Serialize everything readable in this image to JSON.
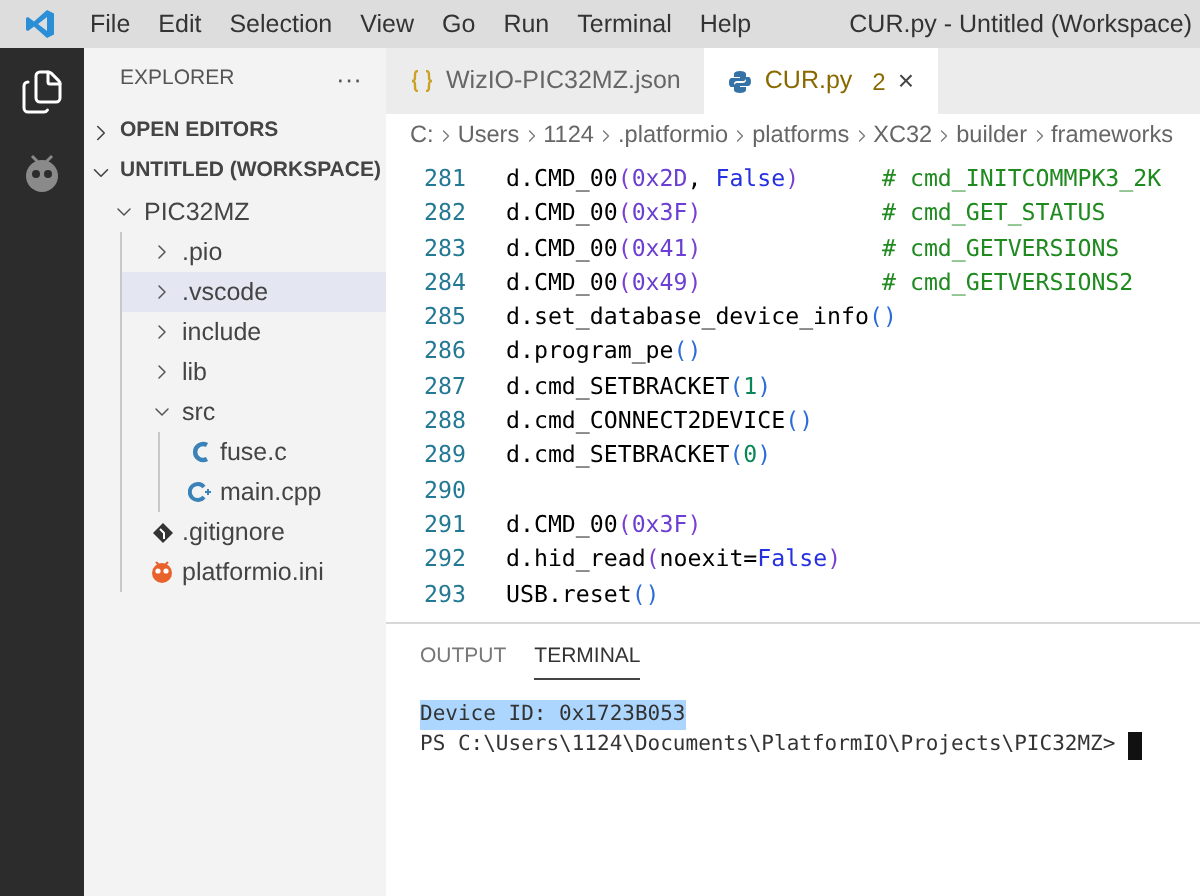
{
  "title_bar": {
    "menu": [
      "File",
      "Edit",
      "Selection",
      "View",
      "Go",
      "Run",
      "Terminal",
      "Help"
    ],
    "title": "CUR.py - Untitled (Workspace)"
  },
  "activity_bar": [
    {
      "kind": "files",
      "selected": true
    },
    {
      "kind": "platformio",
      "selected": false
    }
  ],
  "sidebar": {
    "title": "EXPLORER",
    "more": "···",
    "sections": [
      {
        "label": "OPEN EDITORS",
        "expanded": false
      },
      {
        "label": "UNTITLED (WORKSPACE)",
        "expanded": true,
        "children": [
          {
            "label": "PIC32MZ",
            "kind": "folder",
            "expanded": true,
            "selected": false,
            "children": [
              {
                "label": ".pio",
                "kind": "folder",
                "expanded": false,
                "selected": false
              },
              {
                "label": ".vscode",
                "kind": "folder",
                "expanded": false,
                "selected": true
              },
              {
                "label": "include",
                "kind": "folder",
                "expanded": false,
                "selected": false
              },
              {
                "label": "lib",
                "kind": "folder",
                "expanded": false,
                "selected": false
              },
              {
                "label": "src",
                "kind": "folder",
                "expanded": true,
                "selected": false,
                "children": [
                  {
                    "label": "fuse.c",
                    "kind": "c",
                    "selected": false
                  },
                  {
                    "label": "main.cpp",
                    "kind": "cpp",
                    "selected": false
                  }
                ]
              },
              {
                "label": ".gitignore",
                "kind": "git",
                "selected": false
              },
              {
                "label": "platformio.ini",
                "kind": "ini",
                "selected": false
              }
            ]
          }
        ]
      }
    ]
  },
  "tabs": [
    {
      "label": "WizIO-PIC32MZ.json",
      "kind": "json",
      "selected": false
    },
    {
      "label": "CUR.py",
      "kind": "python",
      "selected": true,
      "badge": "2",
      "close": "×"
    }
  ],
  "breadcrumbs": [
    "C:",
    "Users",
    "1124",
    ".platformio",
    "platforms",
    "XC32",
    "builder",
    "frameworks"
  ],
  "code_lines": [
    {
      "number": "281",
      "tokens": [
        {
          "kind": "plain",
          "text": "d.CMD_00"
        },
        {
          "kind": "paren",
          "text": "("
        },
        {
          "kind": "hex",
          "text": "0x2D"
        },
        {
          "kind": "plain",
          "text": ", "
        },
        {
          "kind": "kw",
          "text": "False"
        },
        {
          "kind": "paren",
          "text": ")"
        }
      ],
      "comment": "# cmd_INITCOMMPK3_2K"
    },
    {
      "number": "282",
      "tokens": [
        {
          "kind": "plain",
          "text": "d.CMD_00"
        },
        {
          "kind": "paren",
          "text": "("
        },
        {
          "kind": "hex",
          "text": "0x3F"
        },
        {
          "kind": "paren",
          "text": ")"
        }
      ],
      "comment": "# cmd_GET_STATUS"
    },
    {
      "number": "283",
      "tokens": [
        {
          "kind": "plain",
          "text": "d.CMD_00"
        },
        {
          "kind": "paren",
          "text": "("
        },
        {
          "kind": "hex",
          "text": "0x41"
        },
        {
          "kind": "paren",
          "text": ")"
        }
      ],
      "comment": "# cmd_GETVERSIONS"
    },
    {
      "number": "284",
      "tokens": [
        {
          "kind": "plain",
          "text": "d.CMD_00"
        },
        {
          "kind": "paren",
          "text": "("
        },
        {
          "kind": "hex",
          "text": "0x49"
        },
        {
          "kind": "paren",
          "text": ")"
        }
      ],
      "comment": "# cmd_GETVERSIONS2"
    },
    {
      "number": "285",
      "tokens": [
        {
          "kind": "plain",
          "text": "d.set_database_device_info"
        },
        {
          "kind": "call",
          "text": "()"
        }
      ]
    },
    {
      "number": "286",
      "tokens": [
        {
          "kind": "plain",
          "text": "d.program_pe"
        },
        {
          "kind": "call",
          "text": "()"
        }
      ]
    },
    {
      "number": "287",
      "tokens": [
        {
          "kind": "plain",
          "text": "d.cmd_SETBRACKET"
        },
        {
          "kind": "call",
          "text": "("
        },
        {
          "kind": "num",
          "text": "1"
        },
        {
          "kind": "call",
          "text": ")"
        }
      ]
    },
    {
      "number": "288",
      "tokens": [
        {
          "kind": "plain",
          "text": "d.cmd_CONNECT2DEVICE"
        },
        {
          "kind": "call",
          "text": "()"
        }
      ]
    },
    {
      "number": "289",
      "tokens": [
        {
          "kind": "plain",
          "text": "d.cmd_SETBRACKET"
        },
        {
          "kind": "call",
          "text": "("
        },
        {
          "kind": "num",
          "text": "0"
        },
        {
          "kind": "call",
          "text": ")"
        }
      ]
    },
    {
      "number": "290"
    },
    {
      "number": "291",
      "tokens": [
        {
          "kind": "plain",
          "text": "d.CMD_00"
        },
        {
          "kind": "paren",
          "text": "("
        },
        {
          "kind": "hex",
          "text": "0x3F"
        },
        {
          "kind": "paren",
          "text": ")"
        }
      ]
    },
    {
      "number": "292",
      "tokens": [
        {
          "kind": "plain",
          "text": "d.hid_read"
        },
        {
          "kind": "paren",
          "text": "("
        },
        {
          "kind": "plain",
          "text": "noexit="
        },
        {
          "kind": "kw",
          "text": "False"
        },
        {
          "kind": "paren",
          "text": ")"
        }
      ]
    },
    {
      "number": "293",
      "tokens": [
        {
          "kind": "plain",
          "text": "USB.reset"
        },
        {
          "kind": "call",
          "text": "()"
        }
      ]
    }
  ],
  "panel": {
    "tabs": [
      {
        "label": "OUTPUT",
        "selected": false
      },
      {
        "label": "TERMINAL",
        "selected": true
      }
    ],
    "lines": [
      {
        "text": "Device ID: 0x1723B053",
        "selected": true
      },
      {
        "text": "PS C:\\Users\\1124\\Documents\\PlatformIO\\Projects\\PIC32MZ>",
        "selected": false,
        "cursor": true
      }
    ]
  }
}
